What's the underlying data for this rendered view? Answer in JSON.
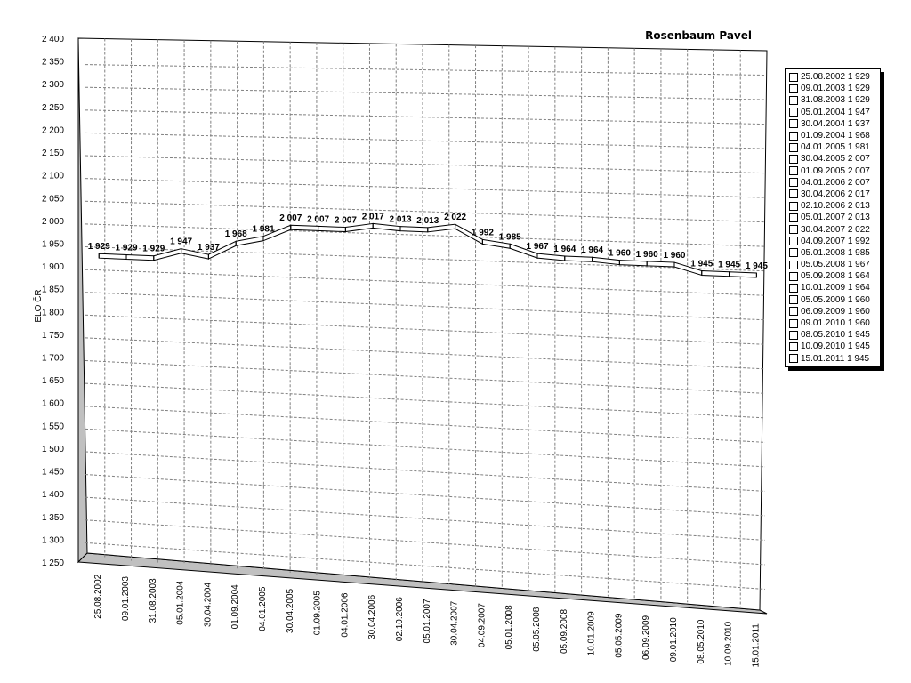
{
  "chart_data": {
    "type": "line",
    "title": "Rosenbaum Pavel",
    "ylabel": "ELO ČR",
    "xlabel": "",
    "ylim": [
      1250,
      2400
    ],
    "yticks": [
      "2 400",
      "2 350",
      "2 300",
      "2 250",
      "2 200",
      "2 150",
      "2 100",
      "2 050",
      "2 000",
      "1 950",
      "1 900",
      "1 850",
      "1 800",
      "1 750",
      "1 700",
      "1 650",
      "1 600",
      "1 550",
      "1 500",
      "1 450",
      "1 400",
      "1 350",
      "1 300",
      "1 250"
    ],
    "grid": true,
    "legend_position": "right",
    "x": [
      "25.08.2002",
      "09.01.2003",
      "31.08.2003",
      "05.01.2004",
      "30.04.2004",
      "01.09.2004",
      "04.01.2005",
      "30.04.2005",
      "01.09.2005",
      "04.01.2006",
      "30.04.2006",
      "02.10.2006",
      "05.01.2007",
      "30.04.2007",
      "04.09.2007",
      "05.01.2008",
      "05.05.2008",
      "05.09.2008",
      "10.01.2009",
      "05.05.2009",
      "06.09.2009",
      "09.01.2010",
      "08.05.2010",
      "10.09.2010",
      "15.01.2011"
    ],
    "series": [
      {
        "values": [
          1929,
          1929,
          1929,
          1947,
          1937,
          1968,
          1981,
          2007,
          2007,
          2007,
          2017,
          2013,
          2013,
          2022,
          1992,
          1985,
          1967,
          1964,
          1964,
          1960,
          1960,
          1960,
          1945,
          1945,
          1945
        ]
      }
    ],
    "data_labels": [
      "1 929",
      "1 929",
      "1 929",
      "1 947",
      "1 937",
      "1 968",
      "1 981",
      "2 007",
      "2 007",
      "2 007",
      "2 017",
      "2 013",
      "2 013",
      "2 022",
      "1 992",
      "1 985",
      "1 967",
      "1 964",
      "1 964",
      "1 960",
      "1 960",
      "1 960",
      "1 945",
      "1 945",
      "1 945"
    ],
    "legend": [
      "25.08.2002 1 929",
      "09.01.2003 1 929",
      "31.08.2003 1 929",
      "05.01.2004 1 947",
      "30.04.2004 1 937",
      "01.09.2004 1 968",
      "04.01.2005 1 981",
      "30.04.2005 2 007",
      "01.09.2005 2 007",
      "04.01.2006 2 007",
      "30.04.2006 2 017",
      "02.10.2006 2 013",
      "05.01.2007 2 013",
      "30.04.2007 2 022",
      "04.09.2007 1 992",
      "05.01.2008 1 985",
      "05.05.2008 1 967",
      "05.09.2008 1 964",
      "10.01.2009 1 964",
      "05.05.2009 1 960",
      "06.09.2009 1 960",
      "09.01.2010 1 960",
      "08.05.2010 1 945",
      "10.09.2010 1 945",
      "15.01.2011 1 945"
    ],
    "colors": {
      "line": "#000000",
      "ribbon": "#ffffff",
      "wall_shadow": "#c0c0c0",
      "grid": "#808080"
    }
  }
}
